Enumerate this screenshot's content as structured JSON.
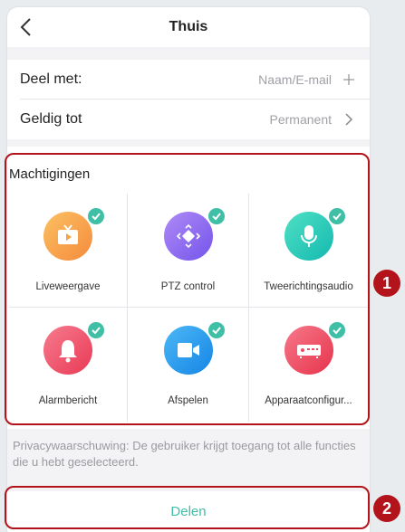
{
  "navbar": {
    "title": "Thuis",
    "back_icon": "chevron-left-icon"
  },
  "share_with": {
    "label": "Deel met:",
    "placeholder": "Naam/E-mail",
    "trail_icon": "plus-icon"
  },
  "valid_until": {
    "label": "Geldig tot",
    "value": "Permanent",
    "trail_icon": "chevron-right-icon"
  },
  "permissions": {
    "title": "Machtigingen",
    "items": [
      {
        "label": "Liveweergave",
        "icon": "tv-icon",
        "color": "#f7a23c",
        "checked": true
      },
      {
        "label": "PTZ control",
        "icon": "ptz-icon",
        "color": "#8f6bf0",
        "checked": true
      },
      {
        "label": "Tweerichtingsaudio",
        "icon": "microphone-icon",
        "color": "#25c9b3",
        "checked": true
      },
      {
        "label": "Alarmbericht",
        "icon": "bell-icon",
        "color": "#f0506a",
        "checked": true
      },
      {
        "label": "Afspelen",
        "icon": "video-camera-icon",
        "color": "#2a9ff0",
        "checked": true
      },
      {
        "label": "Apparaatconfigur...",
        "icon": "device-icon",
        "color": "#f04a60",
        "checked": true
      }
    ]
  },
  "warning": "Privacywaarschuwing: De gebruiker krijgt toegang tot alle functies die u hebt geselecteerd.",
  "share_button": "Delen",
  "annotations": {
    "badge1": "1",
    "badge2": "2",
    "highlight_color": "#b3141c"
  },
  "accent_color": "#3fbfa6"
}
